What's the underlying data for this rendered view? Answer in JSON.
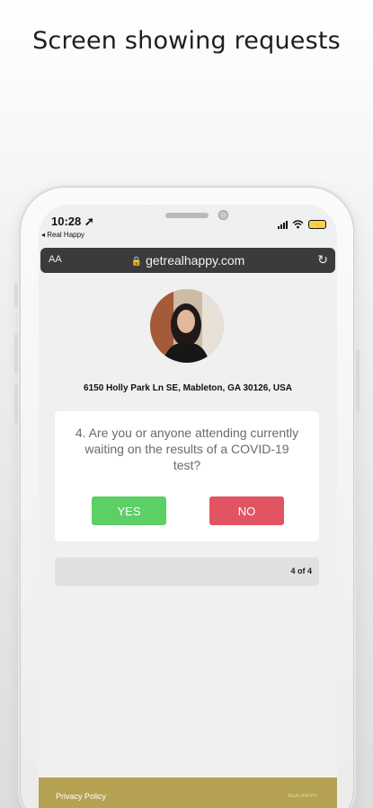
{
  "caption": "Screen showing requests",
  "status_bar": {
    "time": "10:28",
    "back_app": "◂ Real Happy",
    "battery_icon": "battery-charging-icon"
  },
  "browser": {
    "text_size_label": "AA",
    "url": "getrealhappy.com",
    "lock_icon": "lock-icon",
    "reload_icon": "reload-icon"
  },
  "page": {
    "address": "6150 Holly Park Ln SE, Mableton, GA 30126, USA",
    "question": "4. Are you or anyone attending currently waiting on the results of a COVID-19 test?",
    "yes_label": "YES",
    "no_label": "NO",
    "progress_text": "4 of 4",
    "footer_link": "Privacy Policy",
    "footer_logo": "REALHAPPY"
  },
  "colors": {
    "yes": "#5ccf65",
    "no": "#e25462",
    "footer": "#b5a152",
    "url_bar": "#3b3b3b"
  }
}
